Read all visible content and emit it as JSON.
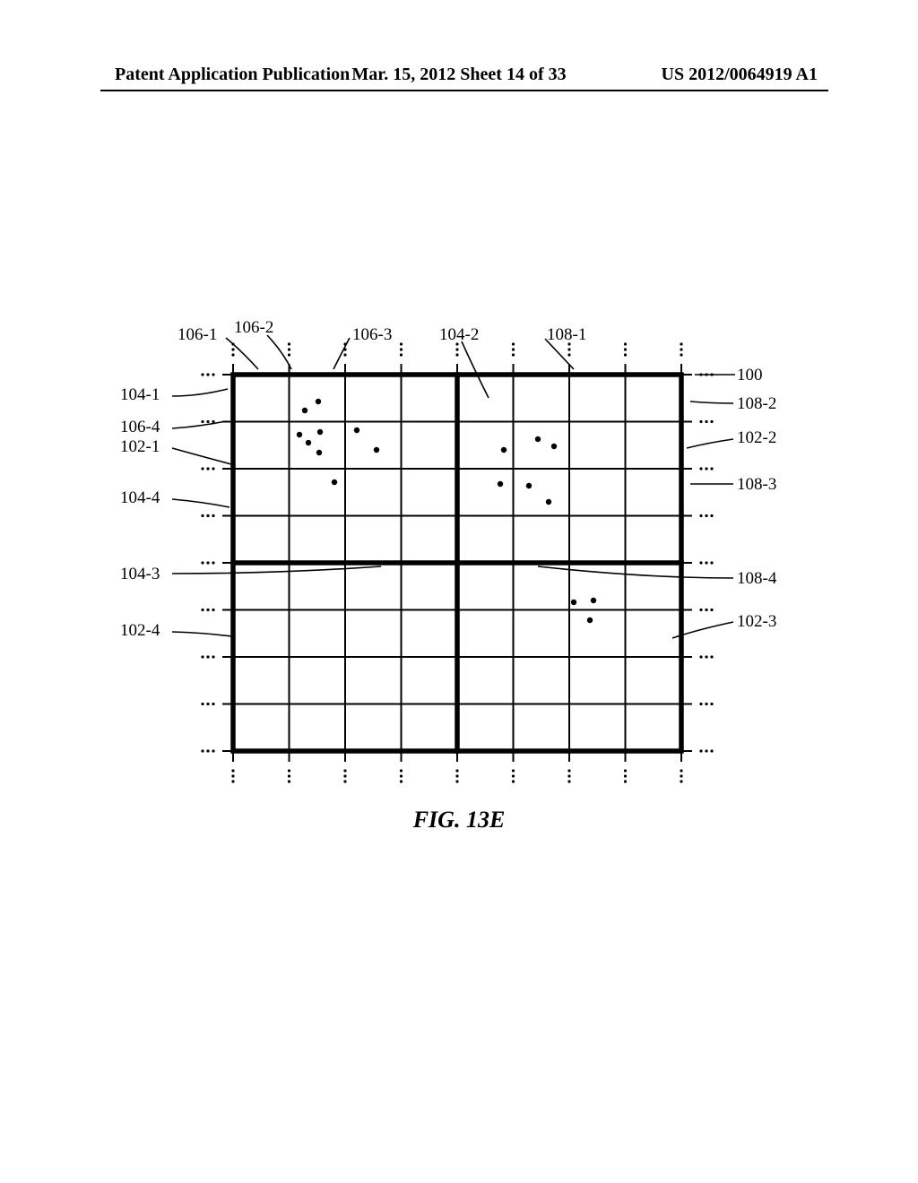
{
  "header": {
    "left": "Patent Application Publication",
    "mid": "Mar. 15, 2012  Sheet 14 of 33",
    "right": "US 2012/0064919 A1"
  },
  "caption": "FIG. 13E",
  "labels": {
    "l_106_1": "106-1",
    "l_106_2": "106-2",
    "l_106_3": "106-3",
    "l_104_2": "104-2",
    "l_108_1": "108-1",
    "l_100": "100",
    "l_104_1": "104-1",
    "l_108_2": "108-2",
    "l_106_4": "106-4",
    "l_102_2": "102-2",
    "l_102_1": "102-1",
    "l_108_3": "108-3",
    "l_104_4": "104-4",
    "l_104_3": "104-3",
    "l_108_4": "108-4",
    "l_102_4": "102-4",
    "l_102_3": "102-3"
  }
}
